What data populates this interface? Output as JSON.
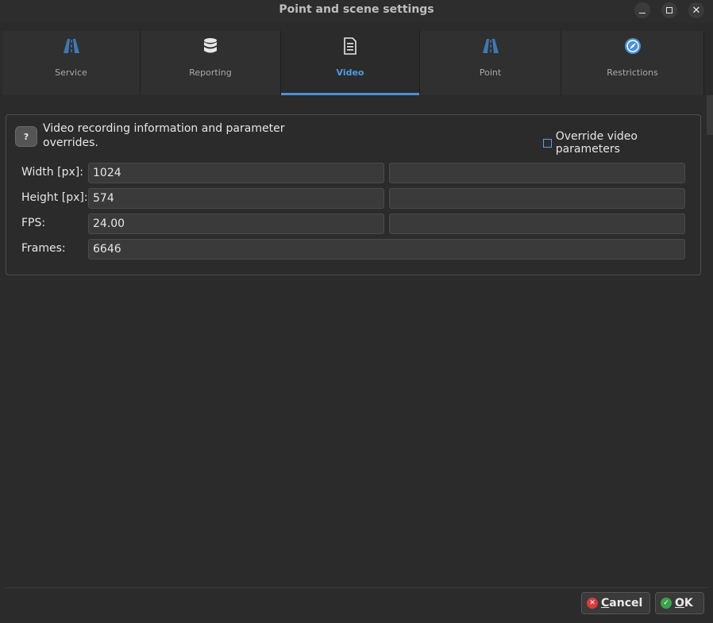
{
  "window": {
    "title": "Point and scene settings",
    "minimize_icon": "minimize-icon",
    "maximize_icon": "maximize-icon",
    "close_icon": "close-icon"
  },
  "tabs": [
    {
      "label": "Service",
      "icon": "road-icon",
      "active": false
    },
    {
      "label": "Reporting",
      "icon": "database-icon",
      "active": false
    },
    {
      "label": "Video",
      "icon": "document-icon",
      "active": true
    },
    {
      "label": "Point",
      "icon": "road-icon",
      "active": false
    },
    {
      "label": "Restrictions",
      "icon": "compass-icon",
      "active": false
    }
  ],
  "video": {
    "info_text": "Video recording information and parameter overrides.",
    "help_label": "?",
    "override_label": "Override video parameters",
    "override_checked": false,
    "rows": [
      {
        "label": "Width [px]:",
        "value": "1024",
        "override": ""
      },
      {
        "label": "Height [px]:",
        "value": "574",
        "override": ""
      },
      {
        "label": "FPS:",
        "value": "24.00",
        "override": ""
      },
      {
        "label": "Frames:",
        "value": "6646"
      }
    ]
  },
  "footer": {
    "cancel_first": "C",
    "cancel_rest": "ancel",
    "ok_first": "O",
    "ok_rest": "K"
  },
  "colors": {
    "accent": "#4a90d9",
    "cancel_icon": "#d93b3b",
    "ok_icon": "#3aa34a"
  }
}
